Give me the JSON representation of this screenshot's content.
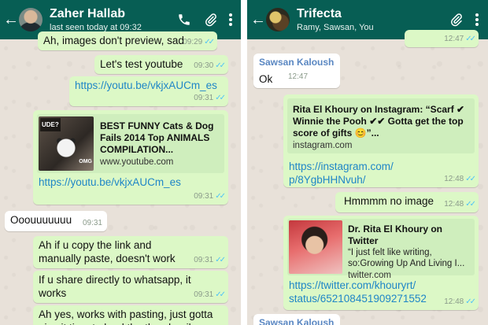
{
  "left": {
    "header": {
      "name": "Zaher Hallab",
      "status": "last seen today at 09:32"
    },
    "messages": {
      "m1": {
        "text": "Ah, images don't preview, sad",
        "time": "09:29"
      },
      "m2": {
        "text": "Let's test youtube",
        "time": "09:30"
      },
      "m3": {
        "text": "https://youtu.be/vkjxAUCm_es",
        "time": "09:31"
      },
      "m4": {
        "preview_title": "BEST FUNNY Cats & Dog Fails 2014 Top ANIMALS COMPILATION...",
        "preview_site": "www.youtube.com",
        "thumb_tag_top": "UDE?",
        "thumb_tag_bottom": "OMG",
        "text": "https://youtu.be/vkjxAUCm_es",
        "time": "09:31"
      },
      "m5": {
        "text": "Ooouuuuuuu",
        "time": "09:31"
      },
      "m6": {
        "text": "Ah if u copy the link and manually paste, doesn't work",
        "time": "09:31"
      },
      "m7": {
        "text": "If u share directly to whatsapp, it works",
        "time": "09:31"
      },
      "m8": {
        "text": "Ah yes, works with pasting, just gotta give it time to load the thumbnail"
      }
    }
  },
  "right": {
    "header": {
      "name": "Trifecta",
      "status": "Ramy, Sawsan, You"
    },
    "messages": {
      "r0": {
        "time": "12:47"
      },
      "r1": {
        "sender": "Sawsan Kaloush",
        "text": "Ok",
        "time": "12:47"
      },
      "r2": {
        "preview_title": "Rita El Khoury on Instagram: “Scarf ✔ Winnie the Pooh ✔✔ Gotta get the top score of gifts 😊”...",
        "preview_site": "instagram.com",
        "text_line1": "https://instagram.com/",
        "text_line2": "p/8YgbHHNvuh/",
        "time": "12:48"
      },
      "r3": {
        "text": "Hmmmm no image",
        "time": "12:48"
      },
      "r4": {
        "preview_title": "Dr. Rita El Khoury on Twitter",
        "preview_desc": "“I just felt like writing, so:Growing Up And Living I...",
        "preview_site": "twitter.com",
        "text_line1": "https://twitter.com/khouryrt/",
        "text_line2": "status/652108451909271552",
        "time": "12:48"
      },
      "r5": {
        "sender": "Sawsan Kaloush"
      }
    }
  },
  "icons": {
    "back": "arrow-back-icon",
    "call": "phone-icon",
    "attach": "paperclip-icon",
    "menu": "more-vert-icon",
    "read": "double-check-icon"
  },
  "colors": {
    "appbar": "#075e54",
    "outgoing_bubble": "#dcf8c6",
    "incoming_bubble": "#ffffff",
    "link": "#1f86c7",
    "read_ticks": "#4fc3f7"
  }
}
